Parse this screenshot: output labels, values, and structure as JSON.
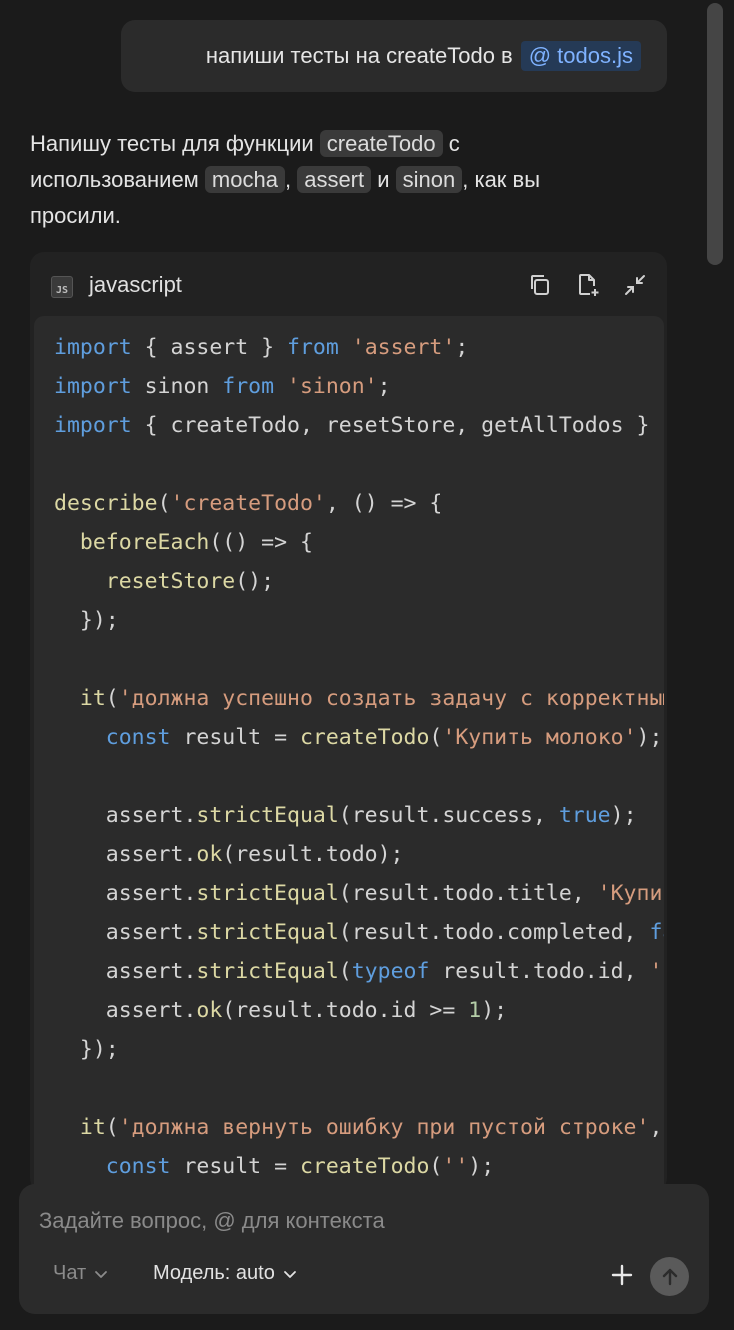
{
  "user_message": {
    "text": "напиши тесты на createTodo в",
    "mention": "@ todos.js"
  },
  "assistant": {
    "p1": "Напишу тесты для функции ",
    "chip1": "createTodo",
    "p2": " с",
    "p3": "использованием ",
    "chip2": "mocha",
    "p4": ", ",
    "chip3": "assert",
    "p5": " и ",
    "chip4": "sinon",
    "p6": ", как вы",
    "p7": "просили."
  },
  "code_block": {
    "language": "javascript",
    "language_icon": "JS",
    "actions": [
      "copy-icon",
      "apply-file-icon",
      "collapse-icon"
    ]
  },
  "input": {
    "placeholder": "Задайте вопрос, @ для контекста",
    "value": "",
    "mode_label": "Чат",
    "model_label": "Модель: auto"
  },
  "colors": {
    "keyword": "#5f9ede",
    "string": "#d69c7e",
    "function": "#dcd8a4",
    "number": "#b5cea8",
    "mention_bg": "#253a56",
    "mention_text": "#7fb2ff"
  }
}
